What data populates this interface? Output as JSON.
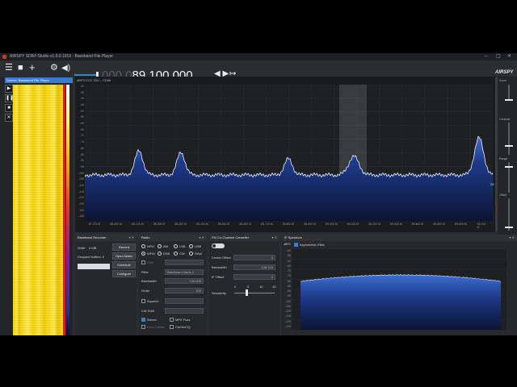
{
  "window": {
    "title": "AIRSPY SDR# Studio v1.0.0.1919 - Baseband File Player",
    "controls": [
      "–",
      "▢",
      "✕"
    ]
  },
  "toolbar": {
    "menu_icon": "hamburger-icon",
    "stop_icon": "stop-icon",
    "add_icon": "plus-icon",
    "settings_icon": "gear-icon",
    "audio_icon": "speaker-icon",
    "frequency_dim": "000.0",
    "frequency_bright": "89.100.000",
    "tune_arrows": "◀ ▶",
    "step_icon": "↦",
    "brand": "AIRSPY"
  },
  "left_panel": {
    "title": "Source: Baseband File Player"
  },
  "spectrum": {
    "header": "dBFS   ECC          333 – CD68",
    "y_ticks": [
      "-30",
      "-35",
      "-40",
      "-45",
      "-50",
      "-55",
      "-60",
      "-65",
      "-70",
      "-75",
      "-80",
      "-85",
      "-90",
      "-95",
      "-100",
      "-105",
      "-110",
      "-115",
      "-120",
      "-125",
      "-130",
      "-135"
    ],
    "x_ticks": [
      "87.700 M",
      "88.000 M",
      "88.100 M",
      "88.200 M",
      "88.300 M",
      "88.400 M",
      "88.500 M",
      "88.600 M",
      "88.700 M",
      "88.800 M",
      "88.900 M",
      "89.000 M",
      "89.100 M",
      "89.200 M",
      "89.300 M",
      "89.400 M",
      "89.500 M",
      "89.600 M",
      "89.700 M"
    ],
    "side_value": "28"
  },
  "right_controls": {
    "zoom": "Zoom",
    "contrast": "Contrast",
    "range": "Range",
    "offset": "Offset"
  },
  "baseband_recorder": {
    "title": "Baseband Recorder",
    "write_label": "Write:",
    "write_value": "0 MB",
    "dropped_label": "Dropped buffers: 0",
    "record": "Record",
    "open_folder": "Open folder",
    "schedule": "Schedule",
    "configure": "Configure"
  },
  "radio": {
    "title": "Radio",
    "modes": [
      "NFM",
      "AM",
      "LSB",
      "USB",
      "WFM",
      "DSB",
      "CW",
      "RAW"
    ],
    "selected_mode": "WFM",
    "shift_label": "Shift",
    "filter_label": "Filter",
    "filter_value": "Blackman-Harris 4",
    "bandwidth_label": "Bandwidth",
    "bandwidth_value": "130,000",
    "order_label": "Order",
    "order_value": "100",
    "squelch_label": "Squelch",
    "cw_shift_label": "CW Shift",
    "stereo_label": "Stereo",
    "mpx_label": "MPX Fuzz",
    "lock_carrier_label": "Lock Carrier",
    "correct_iq_label": "Correct IQ"
  },
  "fm_cochannel": {
    "title": "FM Co-Channel Canceller",
    "center_offset_label": "Center Offset",
    "center_offset_value": "0",
    "bandwidth_label": "Bandwidth",
    "bandwidth_value": "128,125",
    "if_offset_label": "IF Offset",
    "if_offset_value": "0",
    "sensitivity_label": "Sensitivity",
    "scale": [
      "0",
      "5",
      "10",
      "15"
    ]
  },
  "if_spectrum": {
    "title": "IF Spectrum",
    "filter_check_label": "Asymmetric Filter",
    "y_label": "dBFS",
    "y_ticks": [
      "-50",
      "-55",
      "-60",
      "-65",
      "-70",
      "-75",
      "-80",
      "-85",
      "-90",
      "-95",
      "-100",
      "-105",
      "-110",
      "-115",
      "-120",
      "-125"
    ]
  }
}
